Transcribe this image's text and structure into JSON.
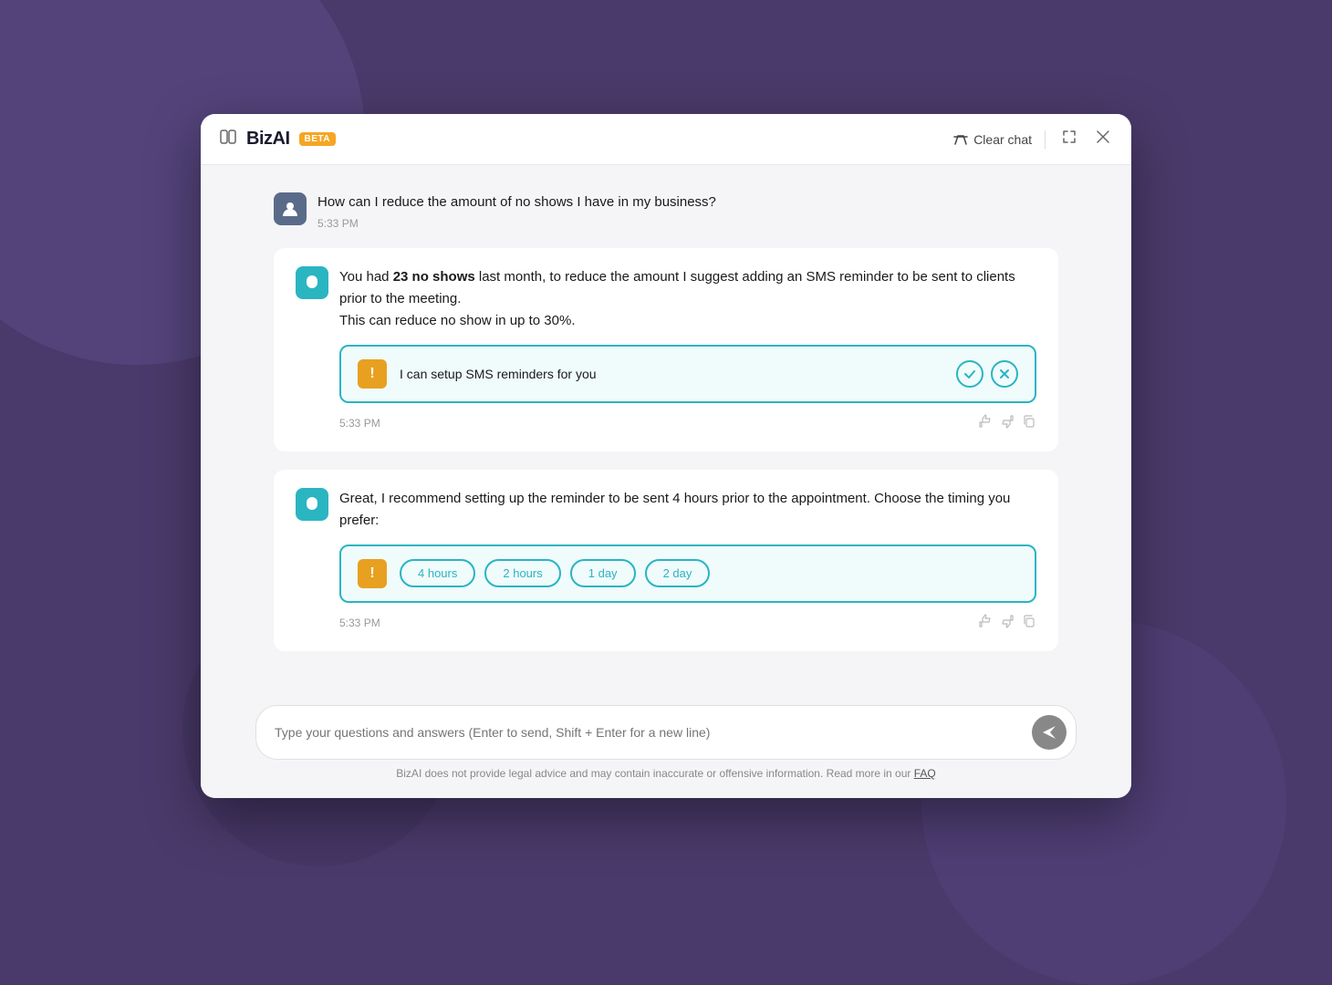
{
  "background": {
    "color": "#4a3a6b"
  },
  "header": {
    "brand_name": "BizAI",
    "beta_label": "BETA",
    "clear_chat_label": "Clear chat",
    "sidebar_icon": "▦",
    "expand_icon": "⤢",
    "close_icon": "✕"
  },
  "messages": [
    {
      "id": "msg-user-1",
      "type": "user",
      "text": "How can I reduce the amount of no shows I have in my business?",
      "time": "5:33 PM"
    },
    {
      "id": "msg-ai-1",
      "type": "ai",
      "text_pre": "You had ",
      "text_bold": "23 no shows",
      "text_post": " last month, to reduce the amount I suggest adding an SMS reminder to be sent to clients prior to the meeting.\nThis can reduce no show in up to 30%.",
      "time": "5:33 PM",
      "action_card": {
        "exclamation": "!",
        "text": "I can setup SMS reminders for you",
        "confirm_icon": "✓",
        "cancel_icon": "✕"
      }
    },
    {
      "id": "msg-ai-2",
      "type": "ai",
      "text": "Great, I recommend setting up the reminder to be sent 4 hours prior to the appointment. Choose the timing you prefer:",
      "time": "5:33 PM",
      "timing_buttons": [
        "4 hours",
        "2 hours",
        "1 day",
        "2 day"
      ]
    }
  ],
  "input": {
    "placeholder": "Type your questions and answers (Enter to send, Shift + Enter for a new line)"
  },
  "disclaimer": {
    "text": "BizAI does not provide legal advice and may contain inaccurate or offensive information. Read more in our ",
    "link_text": "FAQ"
  }
}
